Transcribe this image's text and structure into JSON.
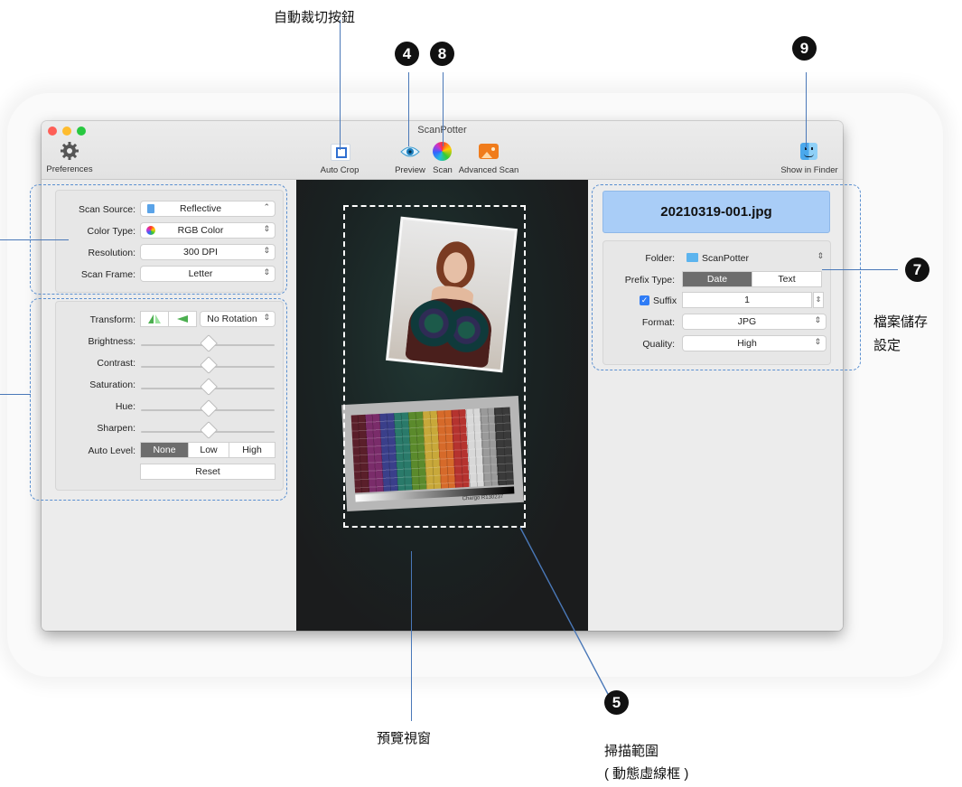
{
  "annotations": {
    "auto_crop_button": "自動裁切按鈕",
    "num4": "4",
    "num8": "8",
    "num9": "9",
    "num7": "7",
    "num5": "5",
    "file_save": "檔案儲存\n設定",
    "preview_window": "預覽視窗",
    "scan_area_1": "掃描範圍",
    "scan_area_2": "( 動態虛線框 )"
  },
  "window": {
    "title": "ScanPotter",
    "toolbar": {
      "preferences": "Preferences",
      "auto_crop": "Auto Crop",
      "preview": "Preview",
      "scan": "Scan",
      "advanced_scan": "Advanced Scan",
      "show_in_finder": "Show in Finder"
    }
  },
  "scan_settings": {
    "rows": [
      {
        "label": "Scan Source:",
        "value": "Reflective"
      },
      {
        "label": "Color Type:",
        "value": "RGB Color"
      },
      {
        "label": "Resolution:",
        "value": "300 DPI"
      },
      {
        "label": "Scan Frame:",
        "value": "Letter"
      }
    ]
  },
  "adjustments": {
    "transform_label": "Transform:",
    "rotation": "No Rotation",
    "sliders": [
      {
        "label": "Brightness:",
        "value": 0.5
      },
      {
        "label": "Contrast:",
        "value": 0.5
      },
      {
        "label": "Saturation:",
        "value": 0.5
      },
      {
        "label": "Hue:",
        "value": 0.5
      },
      {
        "label": "Sharpen:",
        "value": 0.5
      }
    ],
    "auto_level_label": "Auto Level:",
    "auto_level_options": [
      "None",
      "Low",
      "High"
    ],
    "auto_level_selected": "None",
    "reset": "Reset"
  },
  "file": {
    "filename": "20210319-001.jpg",
    "folder_label": "Folder:",
    "folder_value": "ScanPotter",
    "prefix_label": "Prefix Type:",
    "prefix_options": [
      "Date",
      "Text"
    ],
    "prefix_selected": "Date",
    "suffix_label": "Suffix",
    "suffix_checked": true,
    "suffix_value": "1",
    "format_label": "Format:",
    "format_value": "JPG",
    "quality_label": "Quality:",
    "quality_value": "High"
  },
  "preview": {
    "chart_caption": "Chargo R130237"
  },
  "colors": {
    "accent": "#4a78b8",
    "filename_bg": "#a9cdf7",
    "selected_segment": "#6d6d6d"
  }
}
